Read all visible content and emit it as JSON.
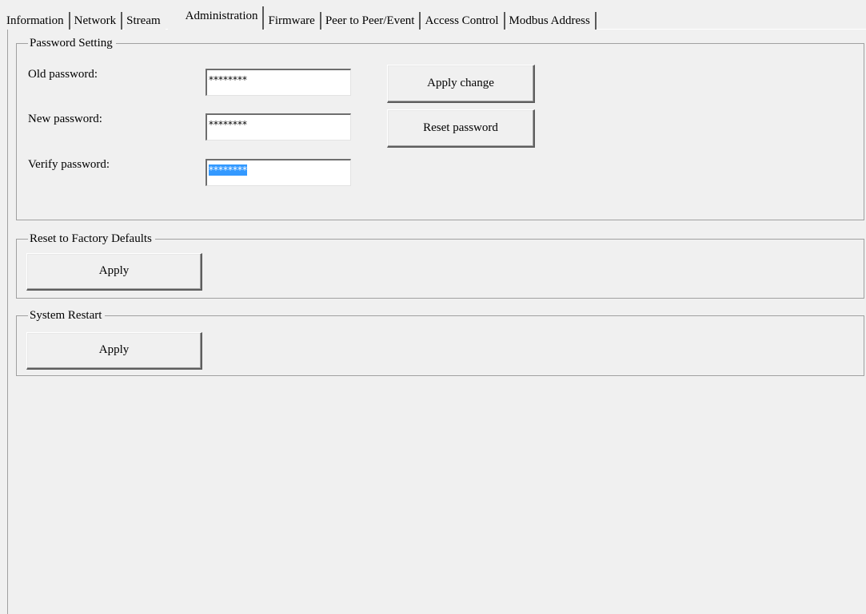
{
  "tabs": [
    {
      "label": "Information",
      "active": false
    },
    {
      "label": "Network",
      "active": false
    },
    {
      "label": "Stream",
      "active": false
    },
    {
      "label": "Administration",
      "active": true
    },
    {
      "label": "Firmware",
      "active": false
    },
    {
      "label": "Peer to Peer/Event",
      "active": false
    },
    {
      "label": "Access Control",
      "active": false
    },
    {
      "label": "Modbus Address",
      "active": false
    }
  ],
  "password_setting": {
    "legend": "Password Setting",
    "old_label": "Old password:",
    "old_value": "********",
    "new_label": "New password:",
    "new_value": "********",
    "verify_label": "Verify password:",
    "verify_value": "********",
    "apply_change_label": "Apply change",
    "reset_password_label": "Reset password"
  },
  "factory_defaults": {
    "legend": "Reset to Factory Defaults",
    "apply_label": "Apply"
  },
  "system_restart": {
    "legend": "System Restart",
    "apply_label": "Apply"
  },
  "colors": {
    "background": "#f0f0f0",
    "selection": "#3399ff"
  }
}
